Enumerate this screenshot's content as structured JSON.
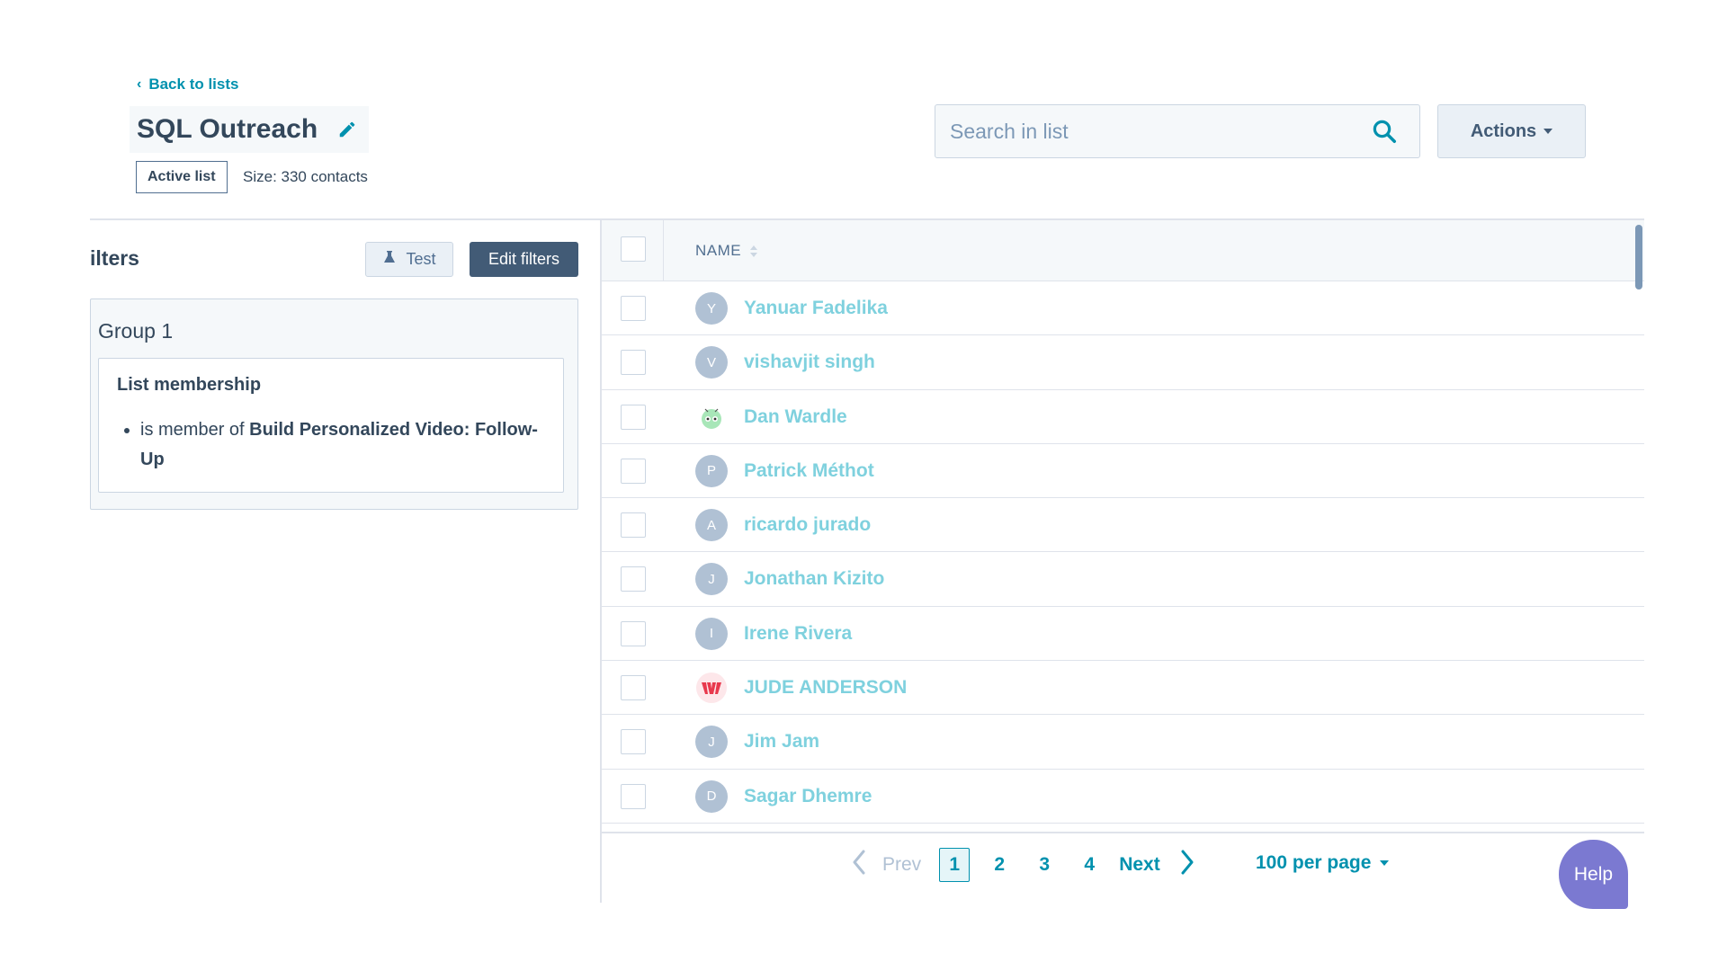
{
  "header": {
    "back_link": "Back to lists",
    "title": "SQL Outreach",
    "badge": "Active list",
    "size_text": "Size: 330 contacts",
    "search_placeholder": "Search in list",
    "actions_label": "Actions"
  },
  "filters": {
    "title": "ilters",
    "test_label": "Test",
    "edit_label": "Edit filters",
    "group_title": "Group 1",
    "membership_title": "List membership",
    "rule_prefix": "is member of",
    "rule_target": "Build Personalized Video: Follow-Up"
  },
  "table": {
    "column_name": "NAME",
    "rows": [
      {
        "initial": "Y",
        "name": "Yanuar Fadelika",
        "avatar": "initial"
      },
      {
        "initial": "V",
        "name": "vishavjit singh",
        "avatar": "initial"
      },
      {
        "initial": "",
        "name": "Dan Wardle",
        "avatar": "robot-icon"
      },
      {
        "initial": "P",
        "name": "Patrick Méthot",
        "avatar": "initial"
      },
      {
        "initial": "A",
        "name": "ricardo jurado",
        "avatar": "initial"
      },
      {
        "initial": "J",
        "name": "Jonathan Kizito",
        "avatar": "initial"
      },
      {
        "initial": "I",
        "name": "Irene Rivera",
        "avatar": "initial"
      },
      {
        "initial": "",
        "name": "JUDE ANDERSON",
        "avatar": "logo-icon"
      },
      {
        "initial": "J",
        "name": "Jim Jam",
        "avatar": "initial"
      },
      {
        "initial": "D",
        "name": "Sagar Dhemre",
        "avatar": "initial"
      }
    ]
  },
  "pagination": {
    "prev_label": "Prev",
    "pages": [
      "1",
      "2",
      "3",
      "4"
    ],
    "active_page": "1",
    "next_label": "Next",
    "per_page_label": "100 per page"
  },
  "help_label": "Help",
  "colors": {
    "accent": "#0091ae",
    "link_light": "#7fd1de",
    "dark_button": "#425b76",
    "help": "#7b79d1"
  }
}
